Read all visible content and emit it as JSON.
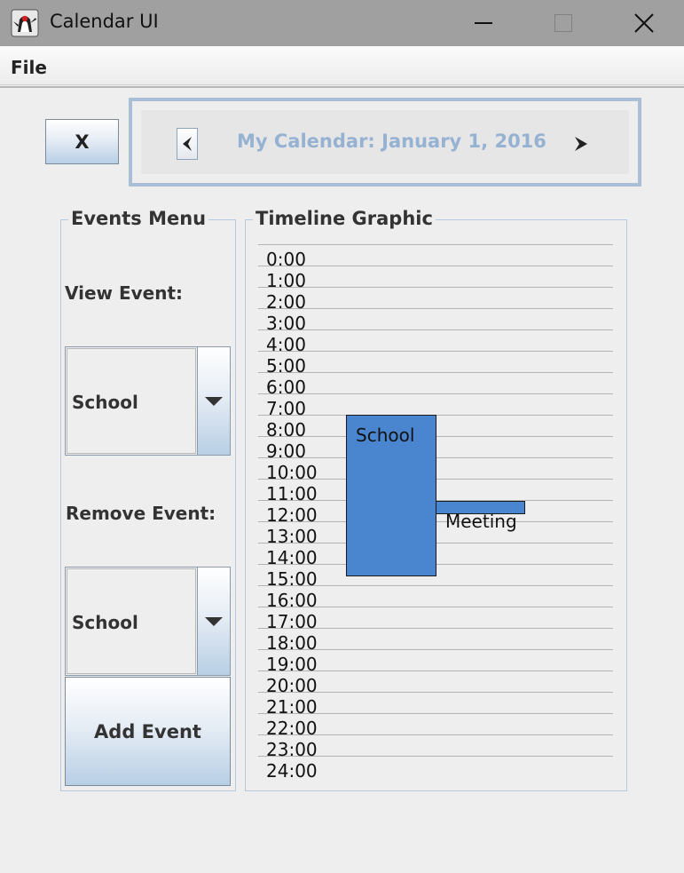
{
  "window": {
    "title": "Calendar UI",
    "icon": "java-duke-icon",
    "controls": [
      "minimize-icon",
      "maximize-icon",
      "close-icon"
    ]
  },
  "menubar": {
    "items": [
      "File"
    ]
  },
  "toolbar": {
    "close_label": "X"
  },
  "header": {
    "title": "My Calendar: January 1, 2016",
    "prev_icon": "chevron-left-icon",
    "next_icon": "chevron-right-icon",
    "title_color": "#96b2d2"
  },
  "events_menu": {
    "title": "Events Menu",
    "view_label": "View Event:",
    "view_selected": "School",
    "remove_label": "Remove Event:",
    "remove_selected": "School",
    "add_label": "Add Event"
  },
  "timeline": {
    "title": "Timeline Graphic",
    "hours": [
      "0:00",
      "1:00",
      "2:00",
      "3:00",
      "4:00",
      "5:00",
      "6:00",
      "7:00",
      "8:00",
      "9:00",
      "10:00",
      "11:00",
      "12:00",
      "13:00",
      "14:00",
      "15:00",
      "16:00",
      "17:00",
      "18:00",
      "19:00",
      "20:00",
      "21:00",
      "22:00",
      "23:00",
      "24:00"
    ],
    "event_color": "#4a86cf",
    "events": [
      {
        "name": "School",
        "start": "7:00",
        "end": "14:30"
      },
      {
        "name": "Meeting",
        "start": "11:00",
        "end": "11:30"
      }
    ]
  }
}
